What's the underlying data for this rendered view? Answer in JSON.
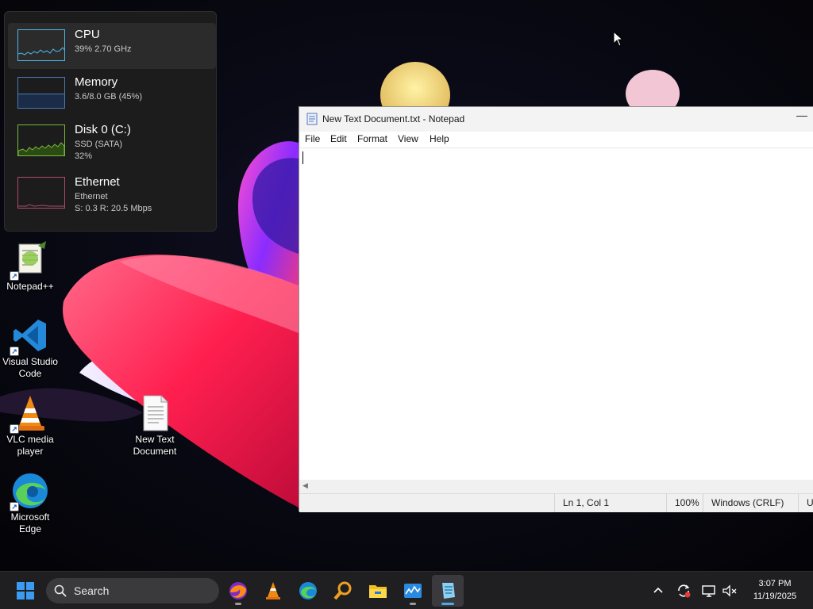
{
  "perf_widget": {
    "items": [
      {
        "name": "CPU",
        "line1": "39% 2.70 GHz",
        "line2": ""
      },
      {
        "name": "Memory",
        "line1": "3.6/8.0 GB (45%)",
        "line2": ""
      },
      {
        "name": "Disk 0 (C:)",
        "line1": "SSD (SATA)",
        "line2": "32%"
      },
      {
        "name": "Ethernet",
        "line1": "Ethernet",
        "line2": "S: 0.3 R: 20.5 Mbps"
      }
    ],
    "colors": {
      "cpu": "#4cb8e8",
      "memory": "#4a7ab8",
      "disk": "#7ab83a",
      "ethernet": "#b04a6a"
    }
  },
  "desktop": {
    "icons": [
      {
        "label": "Notepad++",
        "icon": "notepadpp-icon"
      },
      {
        "label": "Visual Studio Code",
        "icon": "vscode-icon"
      },
      {
        "label": "VLC media player",
        "icon": "vlc-icon"
      },
      {
        "label": "Microsoft Edge",
        "icon": "edge-icon"
      },
      {
        "label": "New Text Document",
        "icon": "text-file-icon"
      }
    ]
  },
  "notepad": {
    "title": "New Text Document.txt - Notepad",
    "minimize_glyph": "—",
    "menu": [
      "File",
      "Edit",
      "Format",
      "View",
      "Help"
    ],
    "content": "",
    "status": {
      "position": "Ln 1, Col 1",
      "zoom": "100%",
      "line_ending": "Windows (CRLF)",
      "encoding": "U"
    }
  },
  "taskbar": {
    "search_label": "Search",
    "pinned": [
      "firefox-icon",
      "vlc-icon",
      "edge-icon",
      "search-tool-icon",
      "file-explorer-icon",
      "monitor-app-icon",
      "notepad-icon"
    ],
    "clock": {
      "time": "3:07 PM",
      "date": "11/19/2025"
    }
  },
  "accent_colors": {
    "windows_blue": "#3a9bf0",
    "taskbar": "#1f1f22"
  }
}
